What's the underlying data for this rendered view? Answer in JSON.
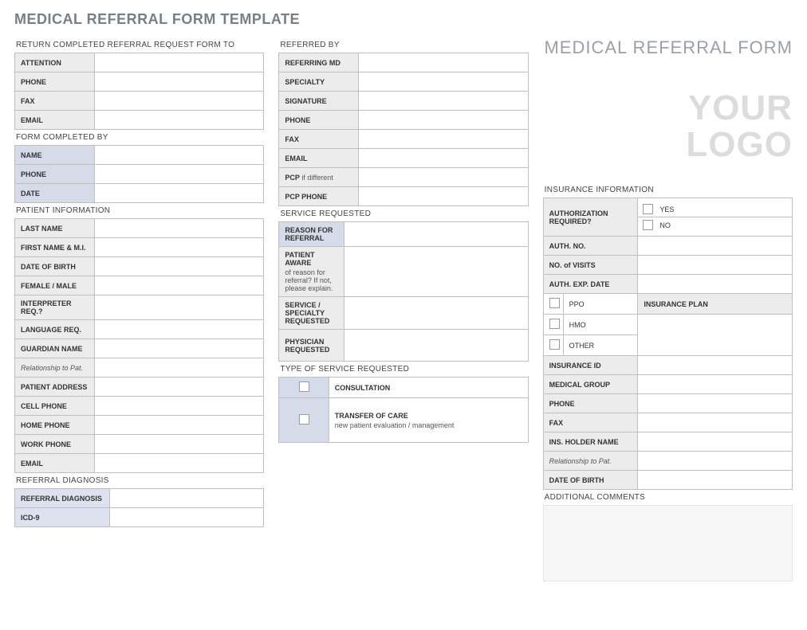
{
  "title": "MEDICAL REFERRAL FORM TEMPLATE",
  "header_right": "MEDICAL REFERRAL FORM",
  "logo_line1": "YOUR",
  "logo_line2": "LOGO",
  "return_to": {
    "heading": "RETURN COMPLETED REFERRAL REQUEST FORM TO",
    "attention": "ATTENTION",
    "phone": "PHONE",
    "fax": "FAX",
    "email": "EMAIL"
  },
  "completed_by": {
    "heading": "FORM COMPLETED BY",
    "name": "NAME",
    "phone": "PHONE",
    "date": "DATE"
  },
  "patient": {
    "heading": "PATIENT INFORMATION",
    "last": "LAST NAME",
    "first": "FIRST NAME & M.I.",
    "dob": "DATE OF BIRTH",
    "sex": "FEMALE / MALE",
    "interp": "INTERPRETER REQ.?",
    "lang": "LANGUAGE REQ.",
    "guardian": "GUARDIAN NAME",
    "rel": "Relationship to Pat.",
    "address": "PATIENT ADDRESS",
    "cell": "CELL PHONE",
    "home": "HOME PHONE",
    "work": "WORK PHONE",
    "email": "EMAIL"
  },
  "ref_diag": {
    "heading": "REFERRAL DIAGNOSIS",
    "label": "REFERRAL DIAGNOSIS",
    "icd": "ICD-9"
  },
  "referred_by": {
    "heading": "REFERRED BY",
    "md": "REFERRING MD",
    "specialty": "SPECIALTY",
    "signature": "SIGNATURE",
    "phone": "PHONE",
    "fax": "FAX",
    "email": "EMAIL",
    "pcp": "PCP",
    "pcp_sub": "if different",
    "pcp_phone": "PCP PHONE"
  },
  "service_req": {
    "heading": "SERVICE REQUESTED",
    "reason": "REASON FOR REFERRAL",
    "aware": "PATIENT AWARE",
    "aware_sub": "of reason for referral?  If not, please explain.",
    "svc": "SERVICE / SPECIALTY REQUESTED",
    "phys": "PHYSICIAN REQUESTED"
  },
  "type_service": {
    "heading": "TYPE OF SERVICE REQUESTED",
    "consult": "CONSULTATION",
    "transfer": "TRANSFER OF CARE",
    "transfer_sub": "new patient evaluation / management"
  },
  "insurance": {
    "heading": "INSURANCE INFORMATION",
    "auth": "AUTHORIZATION REQUIRED?",
    "yes": "YES",
    "no": "NO",
    "auth_no": "AUTH. NO.",
    "visits": "NO. of VISITS",
    "exp": "AUTH. EXP. DATE",
    "ppo": "PPO",
    "hmo": "HMO",
    "other": "OTHER",
    "plan": "INSURANCE PLAN",
    "id": "INSURANCE ID",
    "group": "MEDICAL GROUP",
    "phone": "PHONE",
    "fax": "FAX",
    "holder": "INS. HOLDER NAME",
    "rel": "Relationship to Pat.",
    "dob": "DATE OF BIRTH"
  },
  "comments": {
    "heading": "ADDITIONAL COMMENTS"
  }
}
